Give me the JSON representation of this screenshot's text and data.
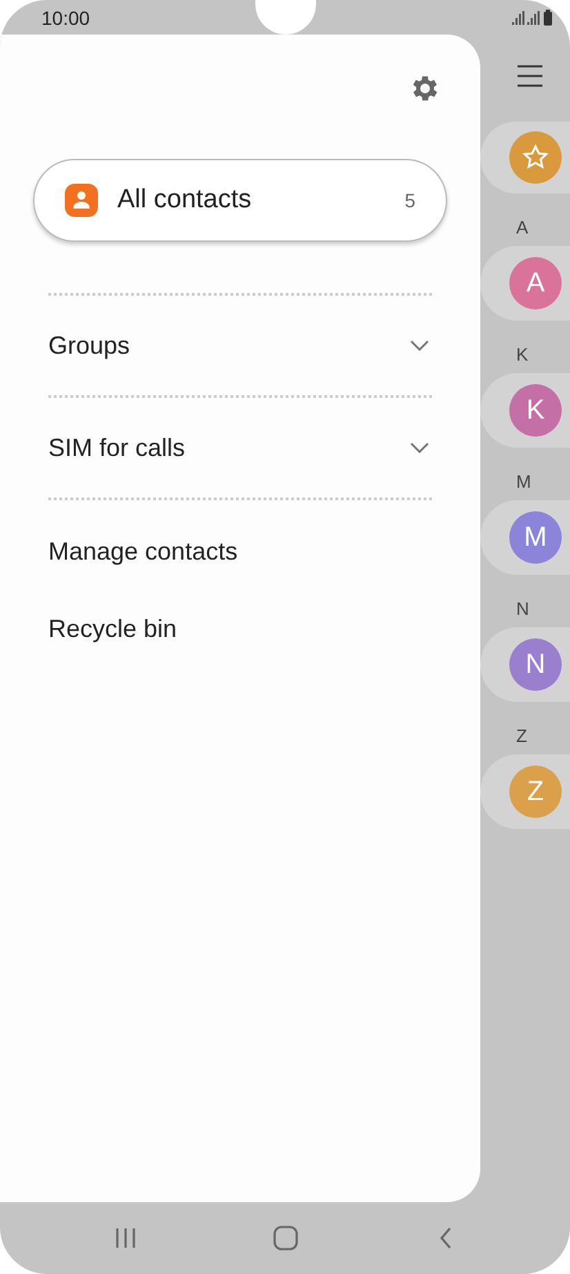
{
  "status_bar": {
    "time": "10:00"
  },
  "drawer": {
    "all_contacts": {
      "label": "All contacts",
      "count": "5",
      "selected": true
    },
    "items": [
      {
        "label": "Groups",
        "kind": "expandable"
      },
      {
        "label": "SIM for calls",
        "kind": "expandable"
      },
      {
        "label": "Manage contacts",
        "kind": "link"
      },
      {
        "label": "Recycle bin",
        "kind": "link"
      }
    ]
  },
  "contact_list": [
    {
      "kind": "favorite",
      "color": "#d99a3e"
    },
    {
      "kind": "contact",
      "section": "A",
      "initial": "A",
      "color": "#d9739a"
    },
    {
      "kind": "contact",
      "section": "K",
      "initial": "K",
      "color": "#c46fa5"
    },
    {
      "kind": "contact",
      "section": "M",
      "initial": "M",
      "color": "#8b84d8"
    },
    {
      "kind": "contact",
      "section": "N",
      "initial": "N",
      "color": "#9a7fcf"
    },
    {
      "kind": "contact",
      "section": "Z",
      "initial": "Z",
      "color": "#dba04a"
    }
  ]
}
